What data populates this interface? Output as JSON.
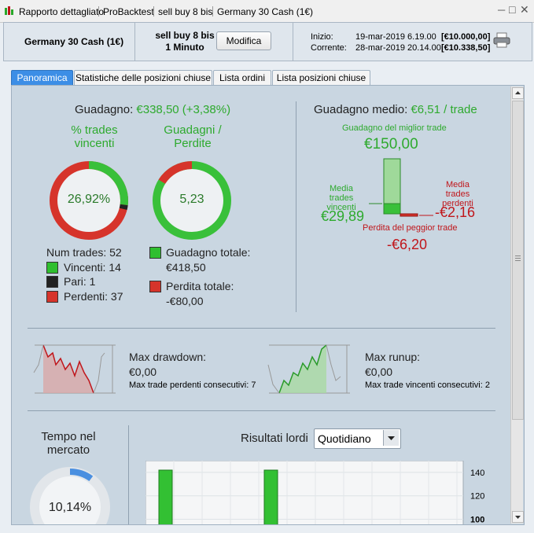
{
  "window": {
    "title_items": [
      "Rapporto dettagliato",
      "ProBacktest",
      "sell buy 8 bis",
      "Germany 30 Cash (1€)"
    ],
    "controls": [
      "─",
      "□",
      "✕"
    ]
  },
  "header": {
    "instrument": "Germany 30 Cash (1€)",
    "strategy_name": "sell buy 8 bis",
    "timeframe": "1 Minuto",
    "modify_label": "Modifica",
    "start_label": "Inizio:",
    "start_date": "19-mar-2019 6.19.00",
    "start_value": "[€10.000,00]",
    "current_label": "Corrente:",
    "current_date": "28-mar-2019 20.14.00",
    "current_value": "[€10.338,50]"
  },
  "tabs": [
    "Panoramica",
    "Statistiche delle posizioni chiuse",
    "Lista ordini",
    "Lista posizioni chiuse"
  ],
  "overview": {
    "gain_label": "Guadagno:",
    "gain_value": "€338,50 (+3,38%)",
    "win_pct_title_1": "% trades",
    "win_pct_title_2": "vincenti",
    "win_pct": "26,92%",
    "win_fraction": 0.2692,
    "pari_fraction": 0.0192,
    "ratio_title_1": "Guadagni /",
    "ratio_title_2": "Perdite",
    "ratio_value": "5,23",
    "ratio_loss_fraction": 0.1607,
    "num_trades_label": "Num trades: 52",
    "winners_label": "Vincenti: 14",
    "even_label": "Pari: 1",
    "losers_label": "Perdenti: 37",
    "total_gain_label": "Guadagno totale:",
    "total_gain_value": "€418,50",
    "total_loss_label": "Perdita totale:",
    "total_loss_value": "-€80,00",
    "avg_gain_label": "Guadagno medio:",
    "avg_gain_value": "€6,51 / trade",
    "best_trade_label": "Guadagno del miglior trade",
    "best_trade_value": "€150,00",
    "avg_win_label_1": "Media trades",
    "avg_win_label_2": "vincenti",
    "avg_win_value": "€29,89",
    "avg_loss_label_1": "Media trades",
    "avg_loss_label_2": "perdenti",
    "avg_loss_value": "-€2,16",
    "worst_trade_label": "Perdita del peggior trade",
    "worst_trade_value": "-€6,20"
  },
  "drawdown": {
    "dd_label": "Max drawdown:",
    "dd_value": "€0,00",
    "dd_consec": "Max trade perdenti consecutivi:",
    "dd_consec_value": "7",
    "ru_label": "Max runup:",
    "ru_value": "€0,00",
    "ru_consec": "Max trade vincenti consecutivi:",
    "ru_consec_value": "2"
  },
  "market_time": {
    "title_1": "Tempo nel",
    "title_2": "mercato",
    "value": "10,14%",
    "fraction": 0.1014
  },
  "results": {
    "title": "Risultati lordi",
    "period_selected": "Quotidiano"
  },
  "chart_data": {
    "type": "bar",
    "title": "Risultati lordi",
    "y_ticks": [
      "140",
      "120",
      "100"
    ],
    "ylim": [
      95,
      150
    ],
    "bars_visible": 2
  },
  "colors": {
    "accent_tab": "#3c8ee6",
    "gain_green": "#2eaa2e",
    "loss_red": "#c0161b",
    "panel_bg": "#c9d6e1"
  }
}
